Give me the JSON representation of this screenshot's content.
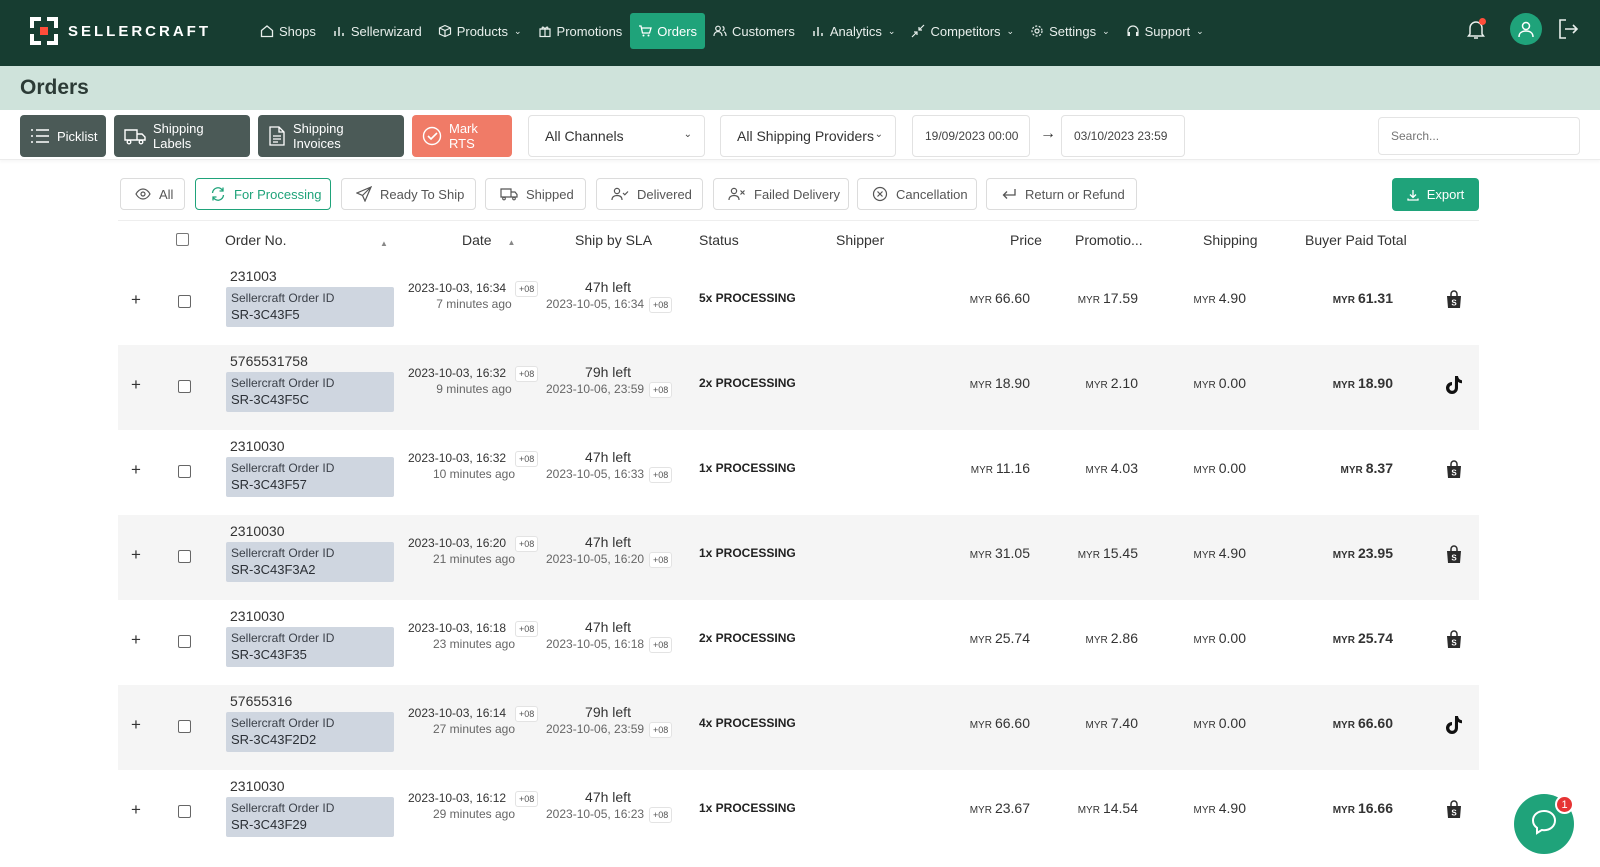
{
  "app": {
    "brand": "SELLERCRAFT",
    "accent": "#1fa37a",
    "nav_bg": "#173d31"
  },
  "nav": {
    "items": [
      {
        "label": "Shops",
        "icon": "home-icon"
      },
      {
        "label": "Sellerwizard",
        "icon": "bar-chart-icon"
      },
      {
        "label": "Products",
        "icon": "box-icon"
      },
      {
        "label": "Promotions",
        "icon": "gift-icon"
      },
      {
        "label": "Orders",
        "icon": "cart-icon"
      },
      {
        "label": "Customers",
        "icon": "users-icon"
      },
      {
        "label": "Analytics",
        "icon": "bar-chart-icon"
      },
      {
        "label": "Competitors",
        "icon": "compress-icon"
      },
      {
        "label": "Settings",
        "icon": "gear-icon"
      },
      {
        "label": "Support",
        "icon": "headset-icon"
      }
    ],
    "notification_count_badge": "dot"
  },
  "page": {
    "title": "Orders"
  },
  "toolbar": {
    "picklist": "Picklist",
    "shipping_labels": "Shipping Labels",
    "shipping_invoices": "Shipping Invoices",
    "mark_rts": "Mark RTS",
    "channel_select": "All Channels",
    "provider_select": "All Shipping Providers",
    "date_from": "19/09/2023 00:00",
    "date_to": "03/10/2023 23:59",
    "search_placeholder": "Search..."
  },
  "filters": {
    "all": "All",
    "for_processing": "For Processing",
    "ready_to_ship": "Ready To Ship",
    "shipped": "Shipped",
    "delivered": "Delivered",
    "failed_delivery": "Failed Delivery",
    "cancellation": "Cancellation",
    "return_refund": "Return or Refund",
    "export": "Export"
  },
  "table": {
    "headers": {
      "order_no": "Order No.",
      "date": "Date",
      "ship_by_sla": "Ship by SLA",
      "status": "Status",
      "shipper": "Shipper",
      "price": "Price",
      "promotion": "Promotio...",
      "shipping": "Shipping",
      "buyer_paid_total": "Buyer Paid Total"
    },
    "sc_label": "Sellercraft Order ID",
    "currency": "MYR",
    "tz": "+08",
    "rows": [
      {
        "order_no": "231003",
        "sc_id": "SR-3C43F5",
        "date": "2023-10-03, 16:34",
        "ago": "7 minutes ago",
        "sla": "47h left",
        "sla_date": "2023-10-05, 16:34",
        "status": "5x PROCESSING",
        "price": "66.60",
        "promo": "17.59",
        "shipping": "4.90",
        "total": "61.31",
        "channel": "shopee"
      },
      {
        "order_no": "5765531758",
        "sc_id": "SR-3C43F5C",
        "date": "2023-10-03, 16:32",
        "ago": "9 minutes ago",
        "sla": "79h left",
        "sla_date": "2023-10-06, 23:59",
        "status": "2x PROCESSING",
        "price": "18.90",
        "promo": "2.10",
        "shipping": "0.00",
        "total": "18.90",
        "channel": "tiktok"
      },
      {
        "order_no": "2310030",
        "sc_id": "SR-3C43F57",
        "date": "2023-10-03, 16:32",
        "ago": "10 minutes ago",
        "sla": "47h left",
        "sla_date": "2023-10-05, 16:33",
        "status": "1x PROCESSING",
        "price": "11.16",
        "promo": "4.03",
        "shipping": "0.00",
        "total": "8.37",
        "channel": "shopee"
      },
      {
        "order_no": "2310030",
        "sc_id": "SR-3C43F3A2",
        "date": "2023-10-03, 16:20",
        "ago": "21 minutes ago",
        "sla": "47h left",
        "sla_date": "2023-10-05, 16:20",
        "status": "1x PROCESSING",
        "price": "31.05",
        "promo": "15.45",
        "shipping": "4.90",
        "total": "23.95",
        "channel": "shopee"
      },
      {
        "order_no": "2310030",
        "sc_id": "SR-3C43F35",
        "date": "2023-10-03, 16:18",
        "ago": "23 minutes ago",
        "sla": "47h left",
        "sla_date": "2023-10-05, 16:18",
        "status": "2x PROCESSING",
        "price": "25.74",
        "promo": "2.86",
        "shipping": "0.00",
        "total": "25.74",
        "channel": "shopee"
      },
      {
        "order_no": "57655316",
        "sc_id": "SR-3C43F2D2",
        "date": "2023-10-03, 16:14",
        "ago": "27 minutes ago",
        "sla": "79h left",
        "sla_date": "2023-10-06, 23:59",
        "status": "4x PROCESSING",
        "price": "66.60",
        "promo": "7.40",
        "shipping": "0.00",
        "total": "66.60",
        "channel": "tiktok"
      },
      {
        "order_no": "2310030",
        "sc_id": "SR-3C43F29",
        "date": "2023-10-03, 16:12",
        "ago": "29 minutes ago",
        "sla": "47h left",
        "sla_date": "2023-10-05, 16:23",
        "status": "1x PROCESSING",
        "price": "23.67",
        "promo": "14.54",
        "shipping": "4.90",
        "total": "16.66",
        "channel": "shopee"
      }
    ]
  },
  "chat": {
    "badge": "1"
  }
}
